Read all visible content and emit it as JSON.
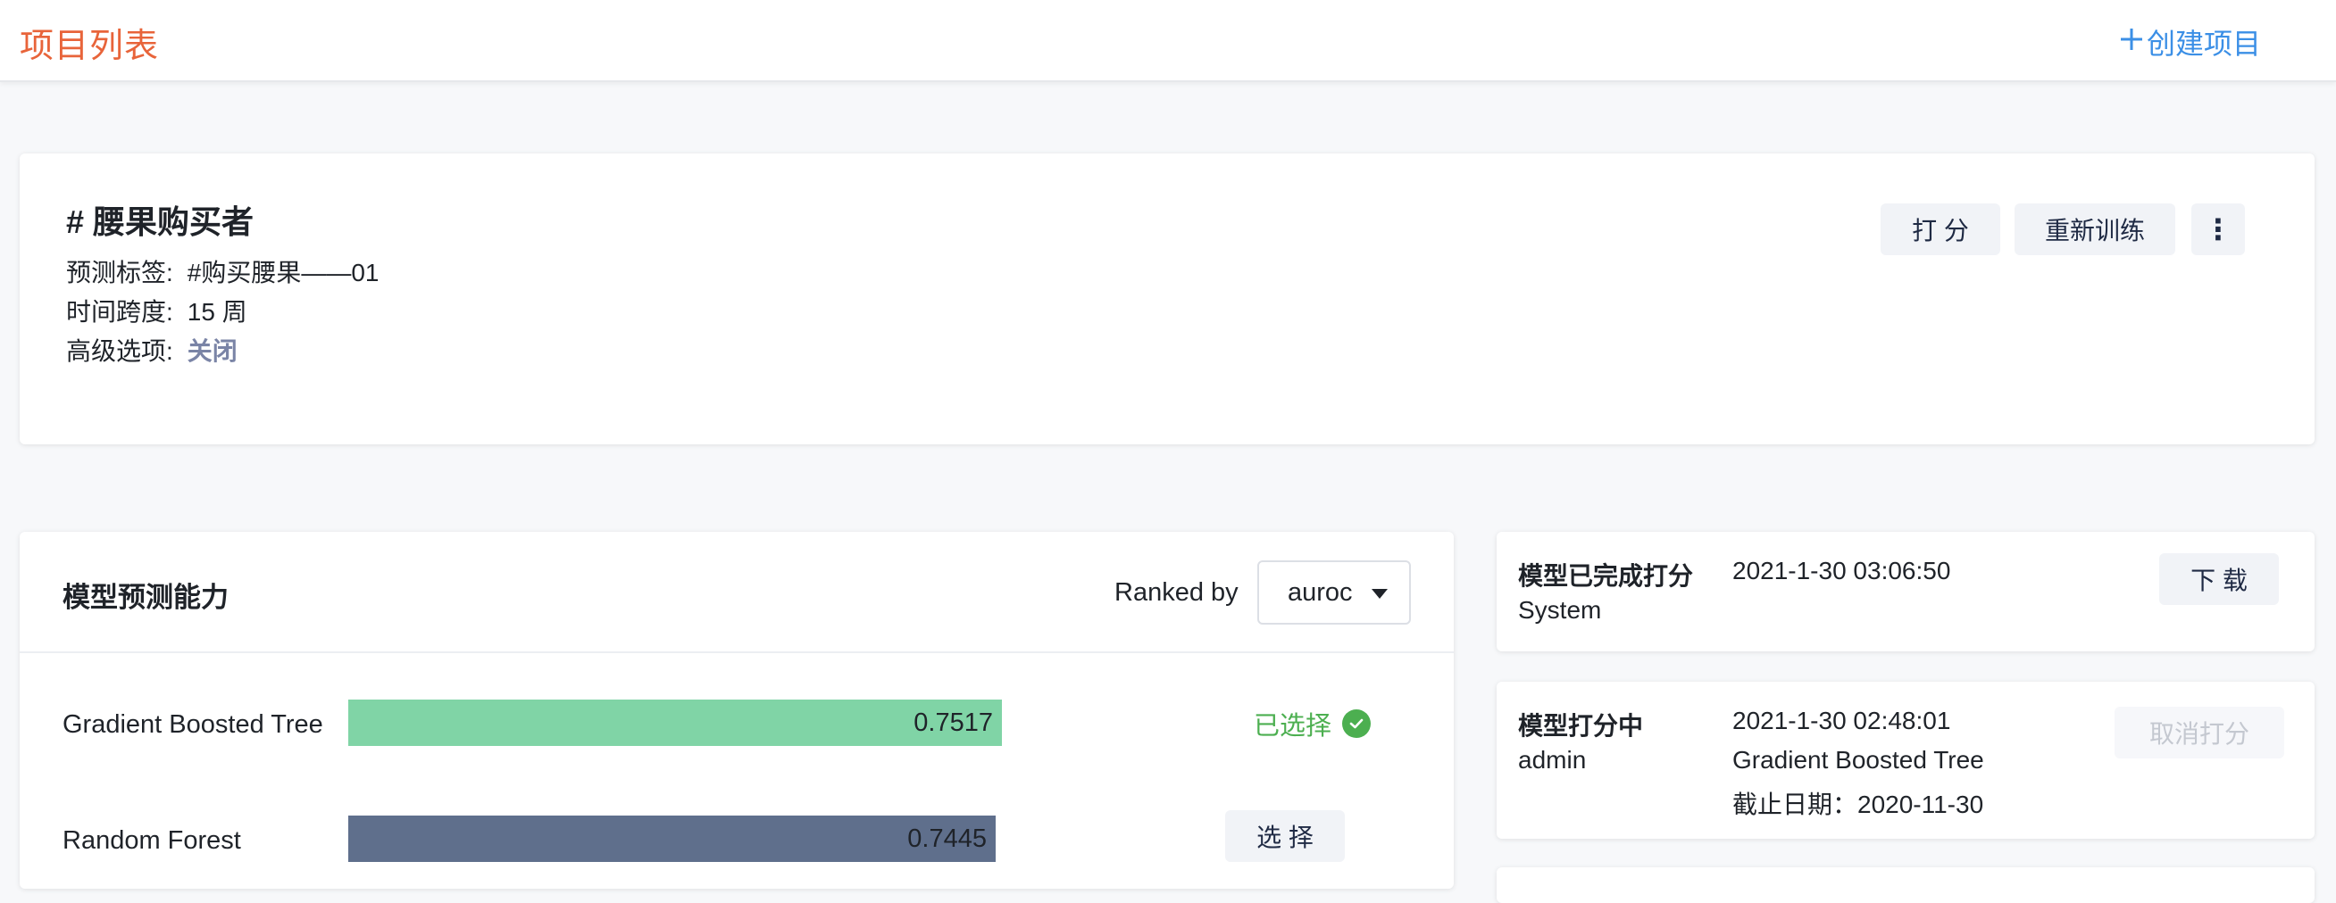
{
  "header": {
    "title": "项目列表",
    "create_icon": "plus-icon",
    "create_label": "创建项目"
  },
  "project": {
    "title": "# 腰果购买者",
    "fields": [
      {
        "label": "预测标签:",
        "value": "#购买腰果——01"
      },
      {
        "label": "时间跨度:",
        "value": "15 周"
      },
      {
        "label": "高级选项:",
        "value": "关闭"
      }
    ],
    "buttons": {
      "score": "打 分",
      "retrain": "重新训练",
      "more_icon": "more-vertical-icon",
      "more_glyph": "⋮"
    }
  },
  "models": {
    "title": "模型预测能力",
    "ranked_by_label": "Ranked by",
    "ranked_by_value": "auroc",
    "rows": [
      {
        "name": "Gradient Boosted Tree",
        "score": "0.7517",
        "fraction": 0.7517,
        "color": "#80d4a6",
        "status": "已选择"
      },
      {
        "name": "Random Forest",
        "score": "0.7445",
        "fraction": 0.7445,
        "color": "#5f6f8c",
        "action": "选 择"
      }
    ]
  },
  "activity": [
    {
      "title": "模型已完成打分",
      "user": "System",
      "time": "2021-1-30 03:06:50",
      "action": "下 载"
    },
    {
      "title": "模型打分中",
      "user": "admin",
      "time": "2021-1-30 02:48:01",
      "model": "Gradient Boosted Tree",
      "deadline": "截止日期：2020-11-30",
      "action": "取消打分"
    }
  ],
  "colors": {
    "brand": "#e8643a",
    "link": "#3b8fe6",
    "success": "#4caf50"
  }
}
